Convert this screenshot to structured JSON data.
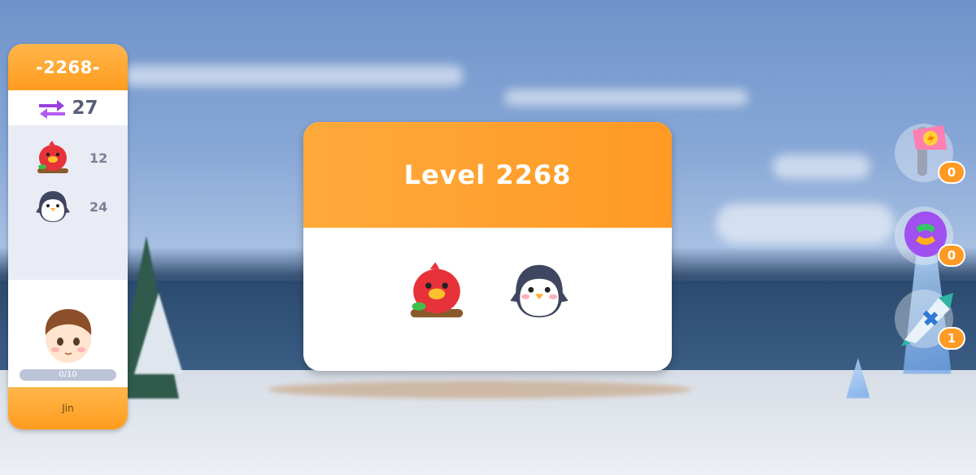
{
  "level_panel": {
    "level_label": "-2268-",
    "moves_count": "27",
    "goals": [
      {
        "icon": "red-bird-icon",
        "count": "12"
      },
      {
        "icon": "penguin-icon",
        "count": "24"
      }
    ],
    "player": {
      "avatar": "boy-avatar",
      "progress_text": "0/10",
      "name": "Jin"
    }
  },
  "level_dialog": {
    "title": "Level 2268",
    "targets": [
      "red-bird-icon",
      "penguin-icon"
    ]
  },
  "boosters": [
    {
      "icon": "axe-booster-icon",
      "count": "0"
    },
    {
      "icon": "shuffle-booster-icon",
      "count": "0"
    },
    {
      "icon": "rocket-booster-icon",
      "count": "1"
    }
  ],
  "colors": {
    "accent_orange": "#ff9c1f",
    "moves_purple": "#9b3fe0"
  }
}
